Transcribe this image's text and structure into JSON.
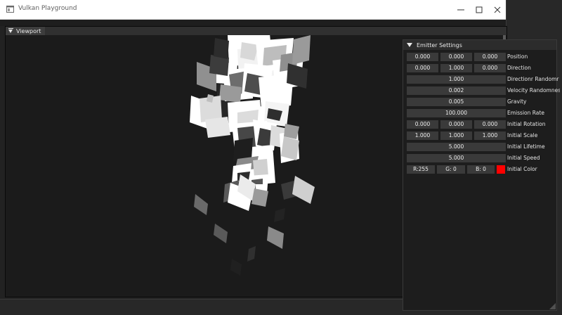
{
  "window": {
    "title": "Vulkan Playground"
  },
  "viewport": {
    "tab_label": "Viewport"
  },
  "emitter": {
    "header": "Emitter Settings",
    "position": {
      "x": "0.000",
      "y": "0.000",
      "z": "0.000",
      "label": "Position"
    },
    "direction": {
      "x": "0.000",
      "y": "1.000",
      "z": "0.000",
      "label": "Direction"
    },
    "direction_randomness": {
      "value": "1.000",
      "label": "Directionr Randomr"
    },
    "velocity_randomness": {
      "value": "0.002",
      "label": "Velocity Randomnes"
    },
    "gravity": {
      "value": "0.005",
      "label": "Gravity"
    },
    "emission_rate": {
      "value": "100.000",
      "label": "Emission Rate"
    },
    "initial_rotation": {
      "x": "0.000",
      "y": "0.000",
      "z": "0.000",
      "label": "Initial Rotation"
    },
    "initial_scale": {
      "x": "1.000",
      "y": "1.000",
      "z": "1.000",
      "label": "Initial Scale"
    },
    "initial_lifetime": {
      "value": "5.000",
      "label": "Initial Lifetime"
    },
    "initial_speed": {
      "value": "5.000",
      "label": "Initial Speed"
    },
    "initial_color": {
      "r": "R:255",
      "g": "G: 0",
      "b": "B: 0",
      "label": "Initial Color",
      "swatch": "#ff0000"
    }
  },
  "colors": {
    "accent_color_swatch": "#ff0000",
    "field_bg": "#3a3a3a",
    "panel_bg": "#1d1d1d"
  },
  "icons": {
    "app": "app-window-icon",
    "minimize": "minimize-icon",
    "maximize": "maximize-icon",
    "close": "close-icon",
    "collapse": "collapse-triangle-icon"
  }
}
